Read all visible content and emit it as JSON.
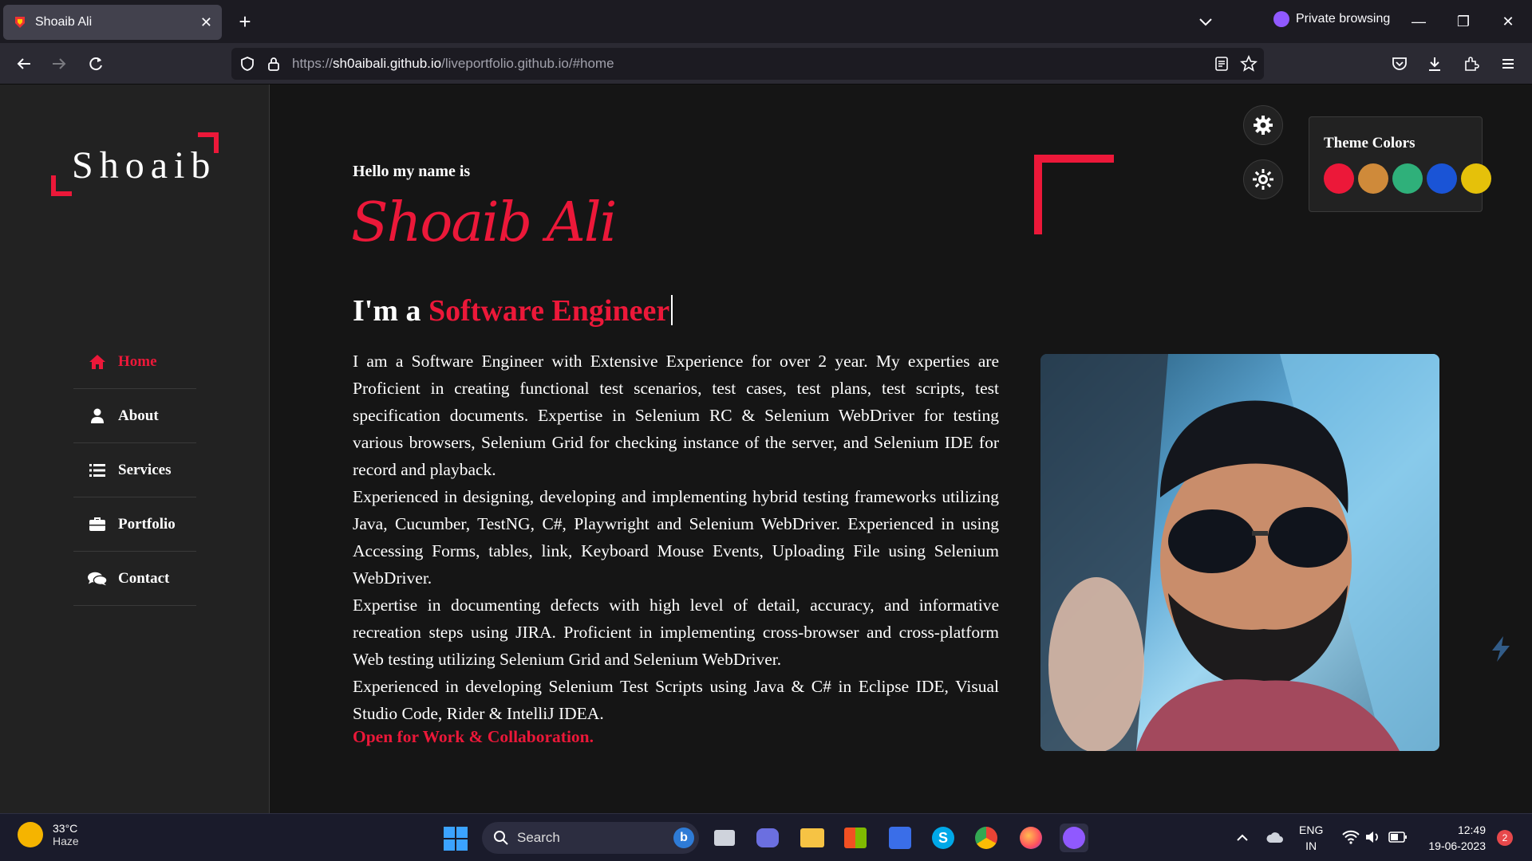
{
  "browser": {
    "tab_title": "Shoaib Ali",
    "url_prefix": "https://",
    "url_host": "sh0aibali.github.io",
    "url_path": "/liveportfolio.github.io/#home",
    "private_label": "Private browsing"
  },
  "sidebar": {
    "logo": "Shoaib",
    "items": [
      {
        "label": "Home",
        "icon": "home-icon",
        "active": true
      },
      {
        "label": "About",
        "icon": "user-icon",
        "active": false
      },
      {
        "label": "Services",
        "icon": "list-icon",
        "active": false
      },
      {
        "label": "Portfolio",
        "icon": "briefcase-icon",
        "active": false
      },
      {
        "label": "Contact",
        "icon": "comments-icon",
        "active": false
      }
    ]
  },
  "hero": {
    "greeting": "Hello my name is",
    "name": "Shoaib Ali",
    "role_prefix": "I'm a ",
    "role": "Software Engineer",
    "bio": [
      "I am a Software Engineer with Extensive Experience for over 2 year. My experties are Proficient in creating functional test scenarios, test cases, test plans, test scripts, test specification documents. Expertise in Selenium RC & Selenium WebDriver for testing various browsers, Selenium Grid for checking instance of the server, and Selenium IDE for record and playback.",
      "Experienced in designing, developing and implementing hybrid testing frameworks utilizing Java, Cucumber, TestNG, C#, Playwright and Selenium WebDriver. Experienced in using Accessing Forms, tables, link, Keyboard Mouse Events, Uploading File using Selenium WebDriver.",
      "Expertise in documenting defects with high level of detail, accuracy, and informative recreation steps using JIRA. Proficient in implementing cross-browser and cross-platform Web testing utilizing Selenium Grid and Selenium WebDriver.",
      "Experienced in developing Selenium Test Scripts using Java & C# in Eclipse IDE, Visual Studio Code, Rider & IntelliJ IDEA."
    ],
    "cta": "Open for Work & Collaboration."
  },
  "theme": {
    "title": "Theme Colors",
    "accent": "#ec1839",
    "colors": [
      "#ec1839",
      "#cf8a3a",
      "#2fb07a",
      "#1a54d6",
      "#e5c10a"
    ]
  },
  "taskbar": {
    "temperature": "33°C",
    "weather": "Haze",
    "search_label": "Search",
    "language": "ENG",
    "region": "IN",
    "time": "12:49",
    "date": "19-06-2023",
    "notifications": "2"
  }
}
